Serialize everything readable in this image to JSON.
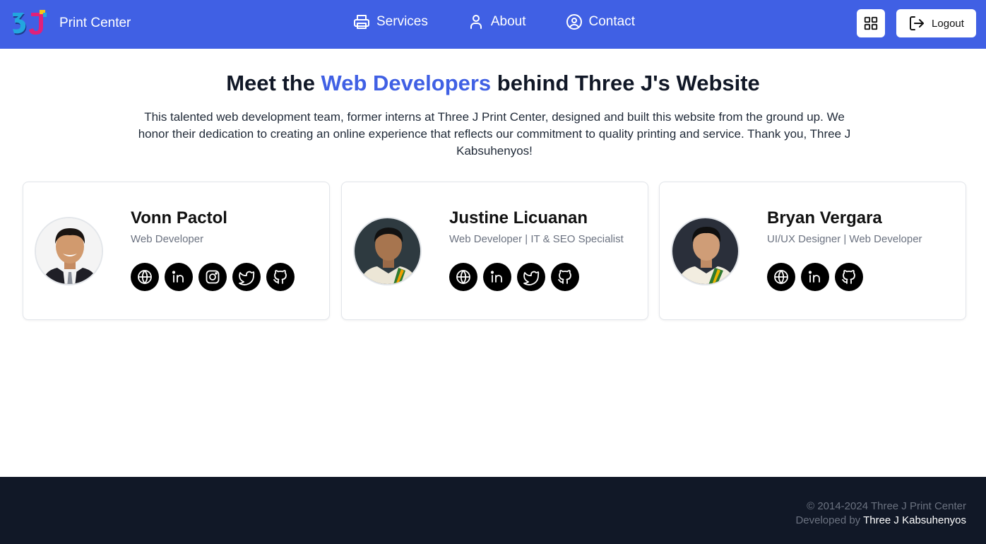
{
  "nav": {
    "brand": "Print Center",
    "links": [
      {
        "label": "Services",
        "icon": "printer-icon"
      },
      {
        "label": "About",
        "icon": "user-icon"
      },
      {
        "label": "Contact",
        "icon": "user-circle-icon"
      }
    ],
    "logout_label": "Logout"
  },
  "hero": {
    "title_pre": "Meet the ",
    "title_accent": "Web Developers",
    "title_post": " behind Three J's Website",
    "intro": "This talented web development team, former interns at Three J Print Center, designed and built this website from the ground up. We honor their dedication to creating an online experience that reflects our commitment to quality printing and service. Thank you, Three J Kabsuhenyos!"
  },
  "team": [
    {
      "name": "Vonn Pactol",
      "role": "Web Developer",
      "socials": [
        "globe-icon",
        "linkedin-icon",
        "instagram-icon",
        "twitter-icon",
        "github-icon"
      ]
    },
    {
      "name": "Justine Licuanan",
      "role": "Web Developer | IT & SEO Specialist",
      "socials": [
        "globe-icon",
        "linkedin-icon",
        "twitter-icon",
        "github-icon"
      ]
    },
    {
      "name": "Bryan Vergara",
      "role": "UI/UX Designer | Web Developer",
      "socials": [
        "globe-icon",
        "linkedin-icon",
        "github-icon"
      ]
    }
  ],
  "footer": {
    "copyright": "© 2014-2024 Three J Print Center",
    "developed_prefix": "Developed by ",
    "developed_by": "Three J Kabsuhenyos"
  },
  "colors": {
    "accent": "#4060e4",
    "footer_bg": "#111827",
    "muted": "#6b7280"
  }
}
